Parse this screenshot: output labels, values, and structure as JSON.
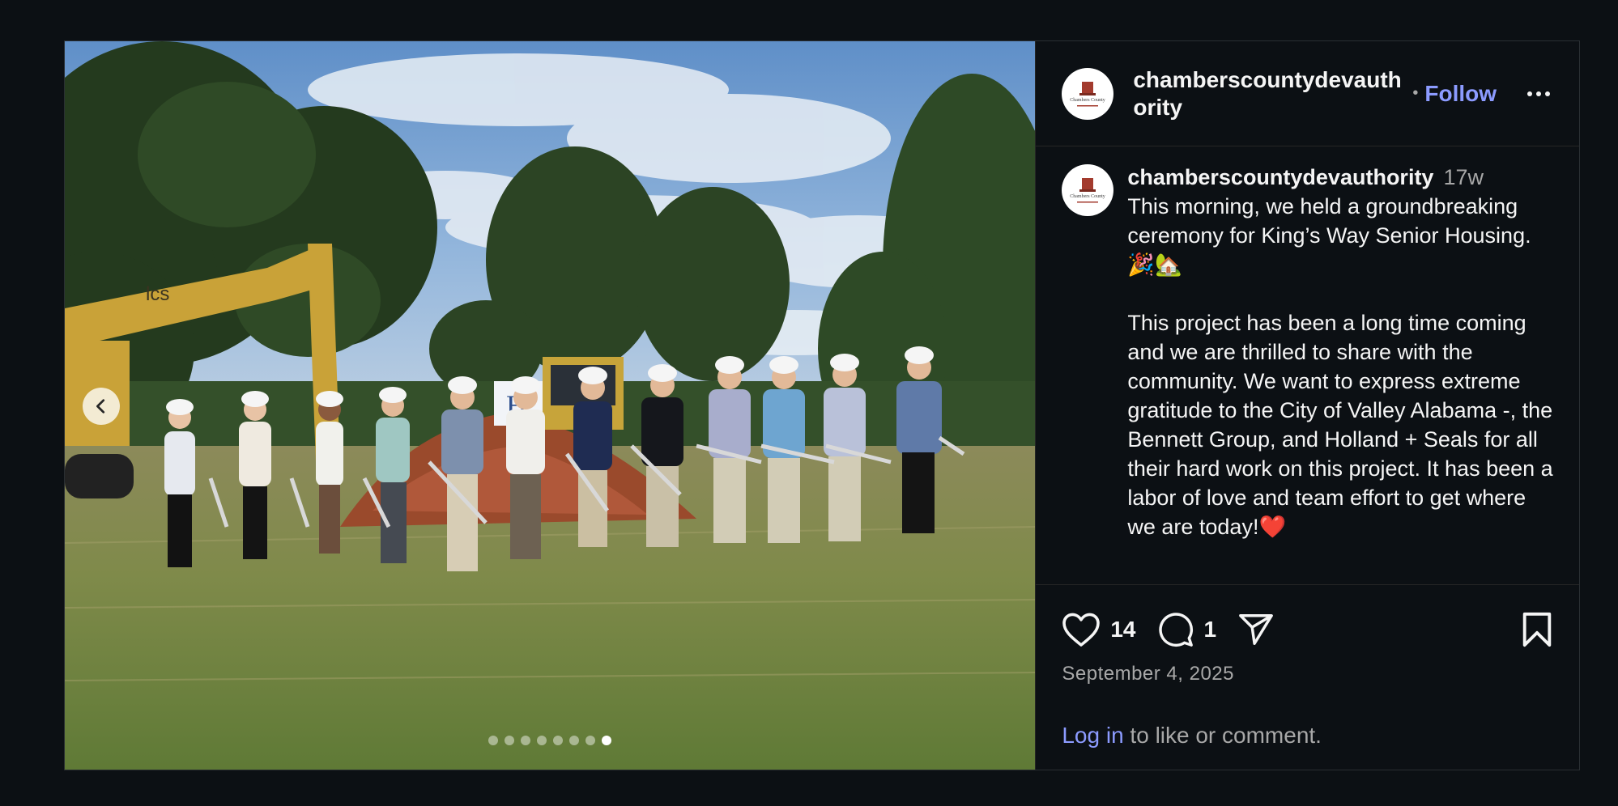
{
  "colors": {
    "background": "#0c1014",
    "link": "#8c9bff",
    "text": "#f5f5f5",
    "muted": "#a8a8a8",
    "heart": "#ff3040"
  },
  "media": {
    "alt_subject": "groundbreaking ceremony photo",
    "carousel_index": 8,
    "carousel_total": 8,
    "excavator_logo": "lcs",
    "sign_letter": "H"
  },
  "header": {
    "username": "chamberscountydevauthority",
    "separator": "•",
    "follow_label": "Follow",
    "more_icon": "more-horizontal-icon",
    "avatar_text": "Chambers County"
  },
  "caption": {
    "username": "chamberscountydevauthority",
    "time_ago": "17w",
    "text": "This morning, we held a groundbreaking ceremony for King’s Way Senior Housing. 🎉🏡\n\nThis project has been a long time coming and we are thrilled to share with the community. We want to express extreme gratitude to the City of Valley Alabama -, the Bennett Group, and Holland + Seals for all their hard work on this project. It has been a labor of love and team effort to get where we are today!❤️"
  },
  "actions": {
    "likes": "14",
    "comments": "1",
    "like_icon": "heart-icon",
    "comment_icon": "comment-icon",
    "share_icon": "share-icon",
    "save_icon": "bookmark-icon"
  },
  "date": "September 4, 2025",
  "login": {
    "link": "Log in",
    "rest": " to like or comment."
  }
}
